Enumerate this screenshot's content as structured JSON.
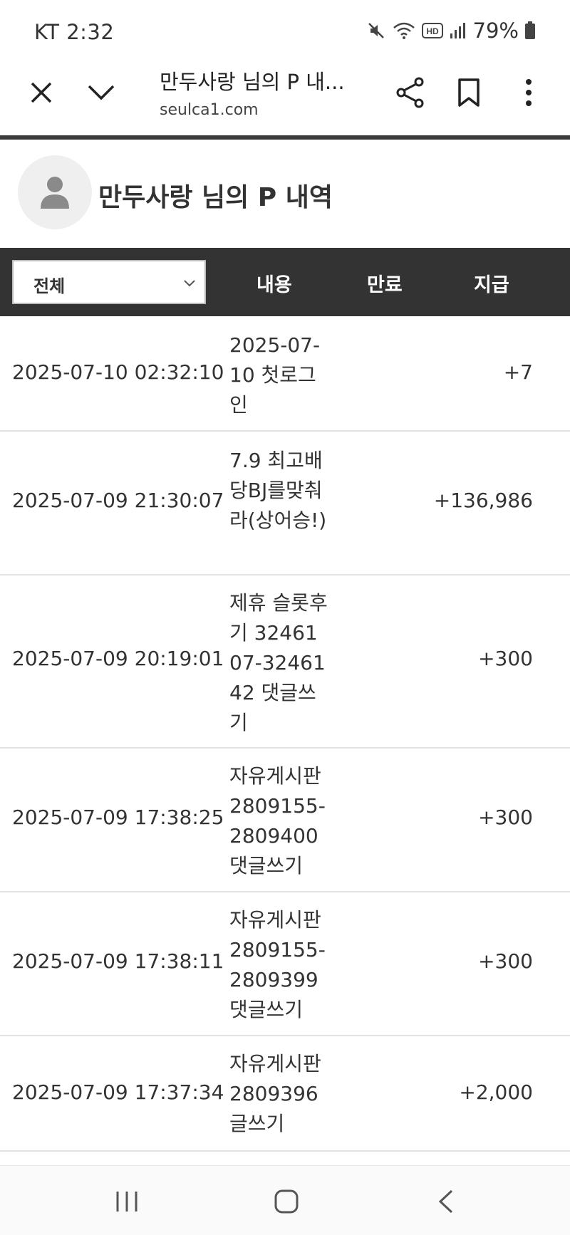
{
  "status_bar": {
    "carrier_time": "KT 2:32",
    "battery": "79%",
    "icons": [
      "mute-icon",
      "wifi-icon",
      "hd-icon",
      "signal-icon",
      "battery-icon"
    ]
  },
  "toolbar": {
    "title": "만두사랑 님의 P 내...",
    "url": "seulca1.com",
    "icons": [
      "close-icon",
      "chevron-down-icon",
      "share-icon",
      "bookmark-icon",
      "more-vertical-icon"
    ]
  },
  "profile": {
    "title": "만두사랑 님의 P 내역"
  },
  "table": {
    "filter": {
      "selected": "전체"
    },
    "headers": {
      "content": "내용",
      "expiry": "만료",
      "amount": "지급"
    },
    "rows": [
      {
        "date": "2025-07-10 02:32:10",
        "content": "2025-07-10 첫로그인",
        "expiry": "",
        "amount": "+7"
      },
      {
        "date": "2025-07-09 21:30:07",
        "content": "7.9 최고배당BJ를맞춰라(상어승!)",
        "expiry": "",
        "amount": "+136,986"
      },
      {
        "date": "2025-07-09 20:19:01",
        "content": "제휴 슬롯후기 3246107-3246142 댓글쓰기",
        "expiry": "",
        "amount": "+300"
      },
      {
        "date": "2025-07-09 17:38:25",
        "content": "자유게시판 2809155-2809400 댓글쓰기",
        "expiry": "",
        "amount": "+300"
      },
      {
        "date": "2025-07-09 17:38:11",
        "content": "자유게시판 2809155-2809399 댓글쓰기",
        "expiry": "",
        "amount": "+300"
      },
      {
        "date": "2025-07-09 17:37:34",
        "content": "자유게시판 2809396 글쓰기",
        "expiry": "",
        "amount": "+2,000"
      }
    ]
  },
  "colors": {
    "header_bg": "#333333",
    "row_divider": "#e2e2e2",
    "avatar_bg": "#efefef"
  }
}
